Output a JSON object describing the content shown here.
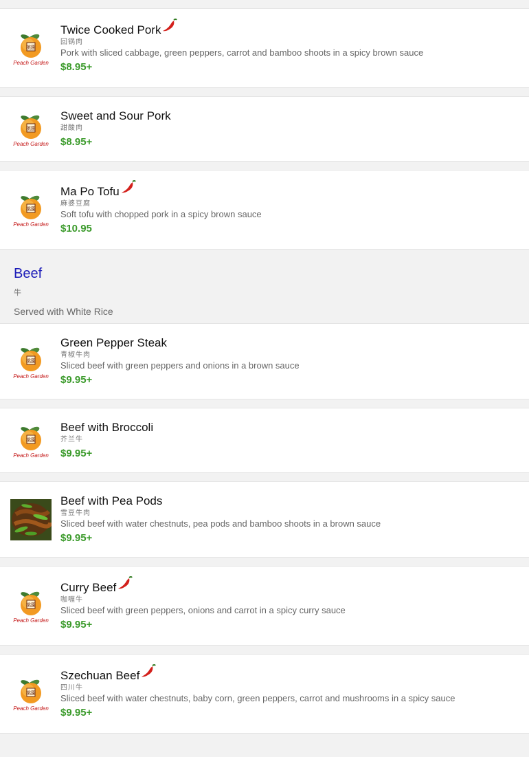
{
  "colors": {
    "accent_blue": "#1c1cb8",
    "price_green": "#3a9a2a",
    "chili_red": "#d3201b"
  },
  "items_top": [
    {
      "name": "Twice Cooked Pork",
      "spicy": true,
      "cn": "回锅肉",
      "desc": "Pork with sliced cabbage, green peppers, carrot and bamboo shoots in a spicy brown sauce",
      "price": "$8.95+",
      "image": "peach-garden-logo"
    },
    {
      "name": "Sweet and Sour Pork",
      "spicy": false,
      "cn": "甜酸肉",
      "desc": "",
      "price": "$8.95+",
      "image": "peach-garden-logo"
    },
    {
      "name": "Ma Po Tofu",
      "spicy": true,
      "cn": "麻婆豆腐",
      "desc": "Soft tofu with chopped pork in a spicy brown sauce",
      "price": "$10.95",
      "image": "peach-garden-logo"
    }
  ],
  "section": {
    "title": "Beef",
    "cn": "牛",
    "note": "Served with White Rice"
  },
  "items_beef": [
    {
      "name": "Green Pepper Steak",
      "spicy": false,
      "cn": "青椒牛肉",
      "desc": "Sliced beef with green peppers and onions in a brown sauce",
      "price": "$9.95+",
      "image": "peach-garden-logo"
    },
    {
      "name": "Beef with Broccoli",
      "spicy": false,
      "cn": "芥兰牛",
      "desc": "",
      "price": "$9.95+",
      "image": "peach-garden-logo"
    },
    {
      "name": "Beef with Pea Pods",
      "spicy": false,
      "cn": "雪豆牛肉",
      "desc": "Sliced beef with water chestnuts, pea pods and bamboo shoots in a brown sauce",
      "price": "$9.95+",
      "image": "food-photo"
    },
    {
      "name": "Curry Beef",
      "spicy": true,
      "cn": "咖喱牛",
      "desc": "Sliced beef with green peppers, onions and carrot in a spicy curry sauce",
      "price": "$9.95+",
      "image": "peach-garden-logo"
    },
    {
      "name": "Szechuan Beef",
      "spicy": true,
      "cn": "四川牛",
      "desc": "Sliced beef with water chestnuts, baby corn, green peppers, carrot and mushrooms in a spicy sauce",
      "price": "$9.95+",
      "image": "peach-garden-logo"
    }
  ],
  "logo_text": "Peach Garden",
  "logo_seal": "桃園"
}
